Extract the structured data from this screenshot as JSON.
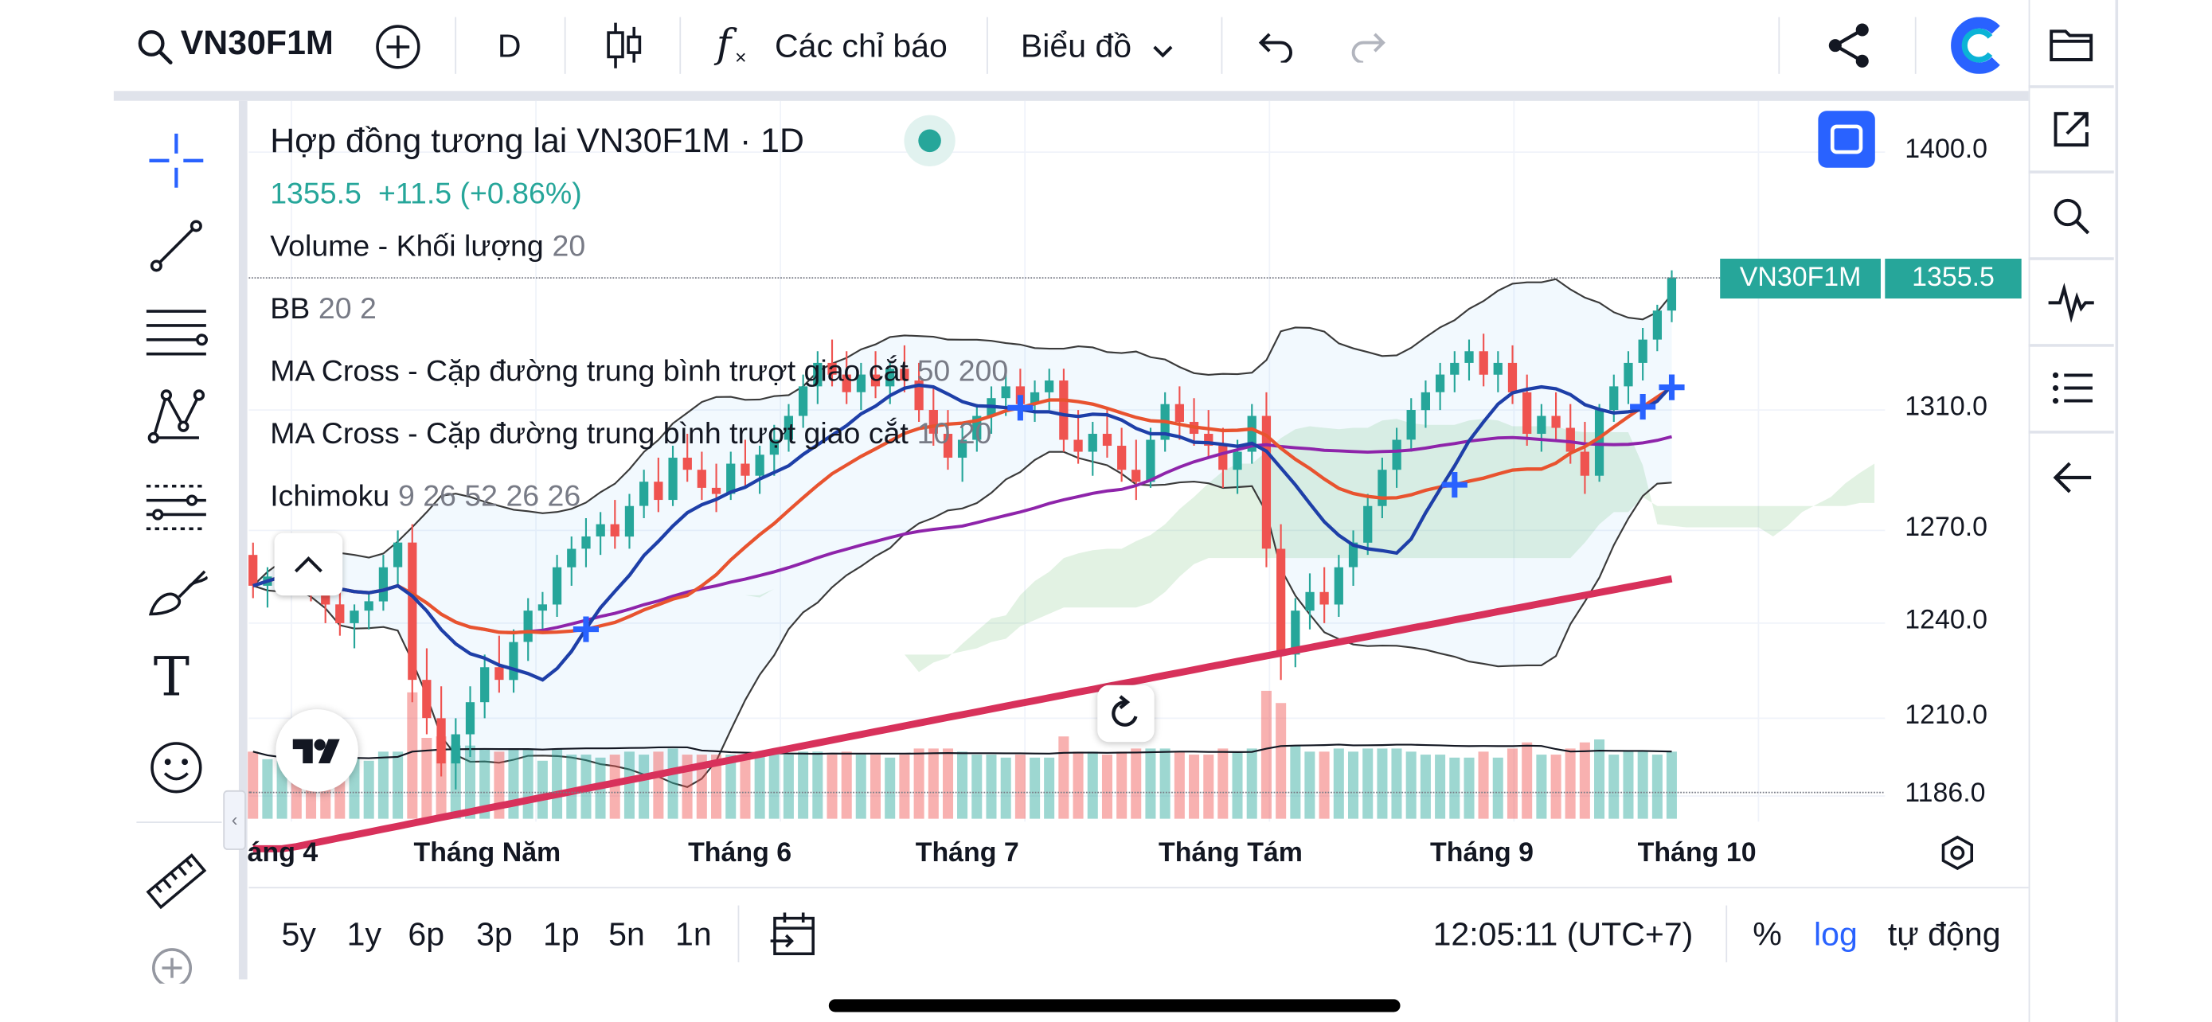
{
  "toolbar": {
    "symbol": "VN30F1M",
    "interval": "D",
    "indicators_label": "Các chỉ báo",
    "chart_type_label": "Biểu đồ"
  },
  "legend": {
    "title": "Hợp đồng tương lai VN30F1M · 1D",
    "last_price": "1355.5",
    "change": "+11.5 (+0.86%)",
    "indicators": [
      {
        "name": "Volume - Khối lượng",
        "params": "20"
      },
      {
        "name": "BB",
        "params": "20 2"
      },
      {
        "name": "MA Cross - Cặp đường trung bình trượt giao cắt",
        "params": "50 200"
      },
      {
        "name": "MA Cross - Cặp đường trung bình trượt giao cắt",
        "params": "10 20"
      },
      {
        "name": "Ichimoku",
        "params": "9 26 52 26 26"
      }
    ]
  },
  "price_tag": {
    "symbol": "VN30F1M",
    "value": "1355.5"
  },
  "bottom_bar": {
    "ranges": [
      "5y",
      "1y",
      "6p",
      "3p",
      "1p",
      "5n",
      "1n"
    ],
    "clock": "12:05:11 (UTC+7)",
    "percent": "%",
    "log": "log",
    "auto": "tự động"
  },
  "colors": {
    "up": "#26a69a",
    "down": "#ef5350",
    "accent": "#2962ff",
    "price_tag": "#26a69a",
    "ma_fast": "#1e3fa8",
    "ma_mid": "#e8532f",
    "ma_slow": "#8e24aa",
    "ma_long": "#d8315b"
  },
  "chart_data": {
    "type": "candlestick",
    "symbol": "VN30F1M",
    "interval": "1D",
    "y_axis": {
      "ticks": [
        1186.0,
        1210.0,
        1240.0,
        1270.0,
        1310.0,
        1400.0
      ],
      "scale": "log",
      "range": [
        1186,
        1400
      ]
    },
    "x_axis": {
      "ticks": [
        "áng 4",
        "Tháng Năm",
        "Tháng 6",
        "Tháng 7",
        "Tháng Tám",
        "Tháng 9",
        "Tháng 10"
      ]
    },
    "last_close": 1355.5,
    "change": 11.5,
    "change_pct": 0.86,
    "ohlc": [
      [
        1262,
        1266,
        1248,
        1252
      ],
      [
        1252,
        1258,
        1245,
        1255
      ],
      [
        1255,
        1262,
        1250,
        1258
      ],
      [
        1258,
        1263,
        1252,
        1256
      ],
      [
        1256,
        1261,
        1247,
        1250
      ],
      [
        1250,
        1255,
        1240,
        1246
      ],
      [
        1246,
        1250,
        1236,
        1240
      ],
      [
        1240,
        1246,
        1232,
        1244
      ],
      [
        1244,
        1250,
        1238,
        1247
      ],
      [
        1247,
        1262,
        1244,
        1258
      ],
      [
        1258,
        1270,
        1252,
        1266
      ],
      [
        1266,
        1272,
        1215,
        1222
      ],
      [
        1222,
        1232,
        1205,
        1210
      ],
      [
        1210,
        1220,
        1192,
        1196
      ],
      [
        1196,
        1210,
        1188,
        1205
      ],
      [
        1205,
        1220,
        1198,
        1215
      ],
      [
        1215,
        1230,
        1210,
        1226
      ],
      [
        1226,
        1236,
        1218,
        1222
      ],
      [
        1222,
        1238,
        1218,
        1234
      ],
      [
        1234,
        1248,
        1228,
        1244
      ],
      [
        1244,
        1250,
        1238,
        1246
      ],
      [
        1246,
        1262,
        1242,
        1258
      ],
      [
        1258,
        1268,
        1252,
        1264
      ],
      [
        1264,
        1274,
        1258,
        1268
      ],
      [
        1268,
        1276,
        1262,
        1272
      ],
      [
        1272,
        1280,
        1264,
        1268
      ],
      [
        1268,
        1282,
        1264,
        1278
      ],
      [
        1278,
        1290,
        1274,
        1286
      ],
      [
        1286,
        1294,
        1276,
        1280
      ],
      [
        1280,
        1298,
        1278,
        1294
      ],
      [
        1294,
        1302,
        1286,
        1290
      ],
      [
        1290,
        1296,
        1280,
        1284
      ],
      [
        1284,
        1292,
        1276,
        1282
      ],
      [
        1282,
        1296,
        1280,
        1292
      ],
      [
        1292,
        1300,
        1284,
        1288
      ],
      [
        1288,
        1298,
        1282,
        1295
      ],
      [
        1295,
        1305,
        1288,
        1300
      ],
      [
        1300,
        1312,
        1296,
        1308
      ],
      [
        1308,
        1322,
        1304,
        1318
      ],
      [
        1318,
        1330,
        1312,
        1326
      ],
      [
        1326,
        1334,
        1318,
        1322
      ],
      [
        1322,
        1330,
        1312,
        1316
      ],
      [
        1316,
        1326,
        1310,
        1322
      ],
      [
        1322,
        1330,
        1314,
        1318
      ],
      [
        1318,
        1326,
        1312,
        1324
      ],
      [
        1324,
        1332,
        1316,
        1320
      ],
      [
        1320,
        1326,
        1306,
        1310
      ],
      [
        1310,
        1318,
        1298,
        1302
      ],
      [
        1302,
        1310,
        1290,
        1294
      ],
      [
        1294,
        1304,
        1286,
        1300
      ],
      [
        1300,
        1312,
        1296,
        1308
      ],
      [
        1308,
        1318,
        1302,
        1314
      ],
      [
        1314,
        1322,
        1308,
        1318
      ],
      [
        1318,
        1324,
        1308,
        1312
      ],
      [
        1312,
        1320,
        1306,
        1316
      ],
      [
        1316,
        1324,
        1310,
        1320
      ],
      [
        1320,
        1324,
        1296,
        1300
      ],
      [
        1300,
        1310,
        1292,
        1296
      ],
      [
        1296,
        1306,
        1288,
        1302
      ],
      [
        1302,
        1310,
        1294,
        1298
      ],
      [
        1298,
        1304,
        1286,
        1290
      ],
      [
        1290,
        1300,
        1280,
        1286
      ],
      [
        1286,
        1304,
        1284,
        1300
      ],
      [
        1300,
        1316,
        1296,
        1312
      ],
      [
        1312,
        1318,
        1300,
        1306
      ],
      [
        1306,
        1314,
        1298,
        1302
      ],
      [
        1302,
        1310,
        1294,
        1298
      ],
      [
        1298,
        1304,
        1284,
        1290
      ],
      [
        1290,
        1300,
        1282,
        1296
      ],
      [
        1296,
        1312,
        1292,
        1308
      ],
      [
        1308,
        1316,
        1258,
        1264
      ],
      [
        1264,
        1272,
        1222,
        1230
      ],
      [
        1230,
        1248,
        1226,
        1244
      ],
      [
        1244,
        1256,
        1238,
        1250
      ],
      [
        1250,
        1258,
        1240,
        1246
      ],
      [
        1246,
        1262,
        1242,
        1258
      ],
      [
        1258,
        1270,
        1252,
        1266
      ],
      [
        1266,
        1282,
        1262,
        1278
      ],
      [
        1278,
        1294,
        1274,
        1290
      ],
      [
        1290,
        1304,
        1284,
        1300
      ],
      [
        1300,
        1314,
        1296,
        1310
      ],
      [
        1310,
        1320,
        1304,
        1316
      ],
      [
        1316,
        1326,
        1310,
        1322
      ],
      [
        1322,
        1330,
        1316,
        1326
      ],
      [
        1326,
        1334,
        1320,
        1330
      ],
      [
        1330,
        1336,
        1318,
        1322
      ],
      [
        1322,
        1330,
        1316,
        1326
      ],
      [
        1326,
        1332,
        1312,
        1316
      ],
      [
        1316,
        1322,
        1298,
        1302
      ],
      [
        1302,
        1312,
        1296,
        1308
      ],
      [
        1308,
        1316,
        1300,
        1304
      ],
      [
        1304,
        1312,
        1292,
        1296
      ],
      [
        1296,
        1306,
        1282,
        1288
      ],
      [
        1288,
        1312,
        1286,
        1310
      ],
      [
        1310,
        1322,
        1306,
        1318
      ],
      [
        1318,
        1330,
        1312,
        1326
      ],
      [
        1326,
        1338,
        1320,
        1334
      ],
      [
        1334,
        1346,
        1330,
        1344
      ],
      [
        1344,
        1358,
        1340,
        1355.5
      ]
    ]
  }
}
